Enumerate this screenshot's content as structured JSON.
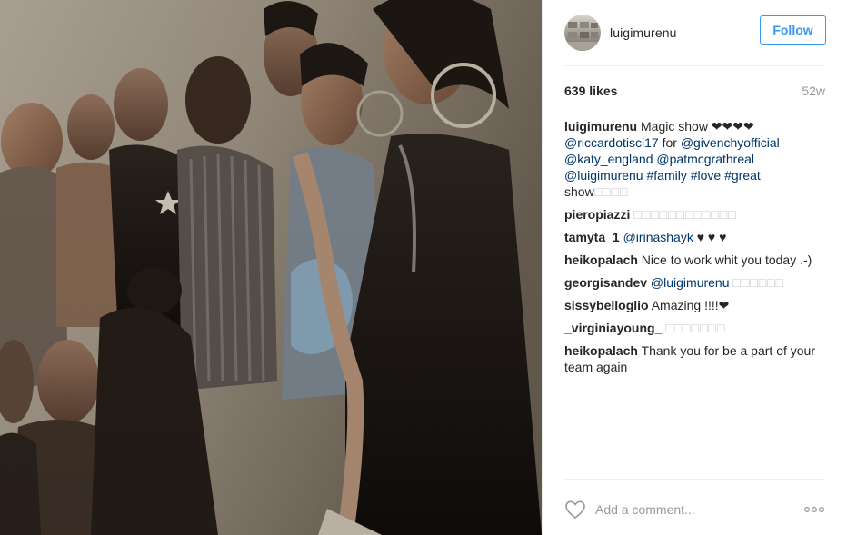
{
  "post": {
    "image_alt": "Group of models in dark backstage light",
    "header": {
      "username": "luigimurenu",
      "follow_label": "Follow"
    },
    "likes": "639 likes",
    "age": "52w",
    "comments": [
      {
        "author": "luigimurenu",
        "parts": [
          {
            "t": "txt",
            "v": " Magic show ❤❤❤❤ "
          },
          {
            "t": "link",
            "v": "@riccardotisci17"
          },
          {
            "t": "txt",
            "v": " for "
          },
          {
            "t": "link",
            "v": "@givenchyofficial"
          },
          {
            "t": "txt",
            "v": " "
          },
          {
            "t": "link",
            "v": "@katy_england"
          },
          {
            "t": "txt",
            "v": " "
          },
          {
            "t": "link",
            "v": "@patmcgrathreal"
          },
          {
            "t": "txt",
            "v": " "
          },
          {
            "t": "link",
            "v": "@luigimurenu"
          },
          {
            "t": "txt",
            "v": " "
          },
          {
            "t": "link",
            "v": "#family"
          },
          {
            "t": "txt",
            "v": " "
          },
          {
            "t": "link",
            "v": "#love"
          },
          {
            "t": "txt",
            "v": " "
          },
          {
            "t": "link",
            "v": "#great"
          },
          {
            "t": "txt",
            "v": " show"
          },
          {
            "t": "box",
            "v": "□□□□"
          }
        ]
      },
      {
        "author": "pieropiazzi",
        "parts": [
          {
            "t": "txt",
            "v": " "
          },
          {
            "t": "box",
            "v": "□□□□□□□□□□□□"
          }
        ]
      },
      {
        "author": "tamyta_1",
        "parts": [
          {
            "t": "txt",
            "v": " "
          },
          {
            "t": "link",
            "v": "@irinashayk"
          },
          {
            "t": "txt",
            "v": " ♥ ♥ ♥"
          }
        ]
      },
      {
        "author": "heikopalach",
        "parts": [
          {
            "t": "txt",
            "v": " Nice to work whit you today .-)"
          }
        ]
      },
      {
        "author": "georgisandev",
        "parts": [
          {
            "t": "txt",
            "v": " "
          },
          {
            "t": "link",
            "v": "@luigimurenu"
          },
          {
            "t": "txt",
            "v": " "
          },
          {
            "t": "box",
            "v": "□□□□□□"
          }
        ]
      },
      {
        "author": "sissybelloglio",
        "parts": [
          {
            "t": "txt",
            "v": " Amazing !!!!❤"
          }
        ]
      },
      {
        "author": "_virginiayoung_",
        "parts": [
          {
            "t": "txt",
            "v": " "
          },
          {
            "t": "box",
            "v": "□□□□□□□"
          }
        ]
      },
      {
        "author": "heikopalach",
        "parts": [
          {
            "t": "txt",
            "v": " Thank you for be a part of your team again"
          }
        ]
      }
    ],
    "footer": {
      "comment_placeholder": "Add a comment..."
    }
  },
  "colors": {
    "link": "#003569",
    "follow": "#3897f0",
    "muted": "#999999",
    "divider": "#efefef"
  },
  "icons": {
    "like": "heart-icon",
    "options": "more-options-icon"
  }
}
